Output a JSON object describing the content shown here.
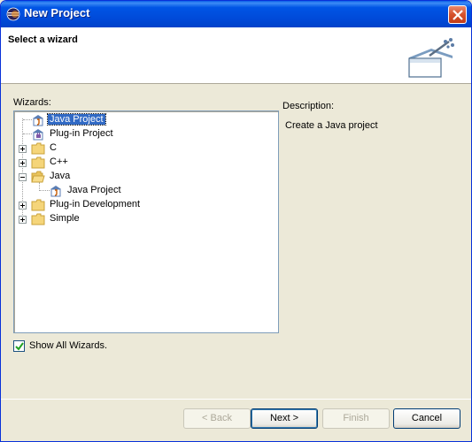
{
  "window": {
    "title": "New Project"
  },
  "header": {
    "title": "Select a wizard"
  },
  "wizards": {
    "label": "Wizards:",
    "items": [
      {
        "label": "Java Project",
        "icon": "java-project-icon",
        "selected": true
      },
      {
        "label": "Plug-in Project",
        "icon": "plugin-project-icon"
      },
      {
        "label": "C",
        "icon": "folder-icon",
        "expander": "plus"
      },
      {
        "label": "C++",
        "icon": "folder-icon",
        "expander": "plus"
      },
      {
        "label": "Java",
        "icon": "folder-open-icon",
        "expander": "minus"
      },
      {
        "label": "Java Project",
        "icon": "java-project-icon",
        "child": true
      },
      {
        "label": "Plug-in Development",
        "icon": "folder-icon",
        "expander": "plus"
      },
      {
        "label": "Simple",
        "icon": "folder-icon",
        "expander": "plus"
      }
    ]
  },
  "description": {
    "label": "Description:",
    "text": "Create a Java project"
  },
  "show_all": {
    "label": "Show All Wizards.",
    "checked": true
  },
  "buttons": {
    "back": "< Back",
    "next": "Next >",
    "finish": "Finish",
    "cancel": "Cancel"
  },
  "colors": {
    "titlebar": "#0055E5",
    "selection": "#316AC5",
    "dialog_bg": "#ECE9D8"
  }
}
